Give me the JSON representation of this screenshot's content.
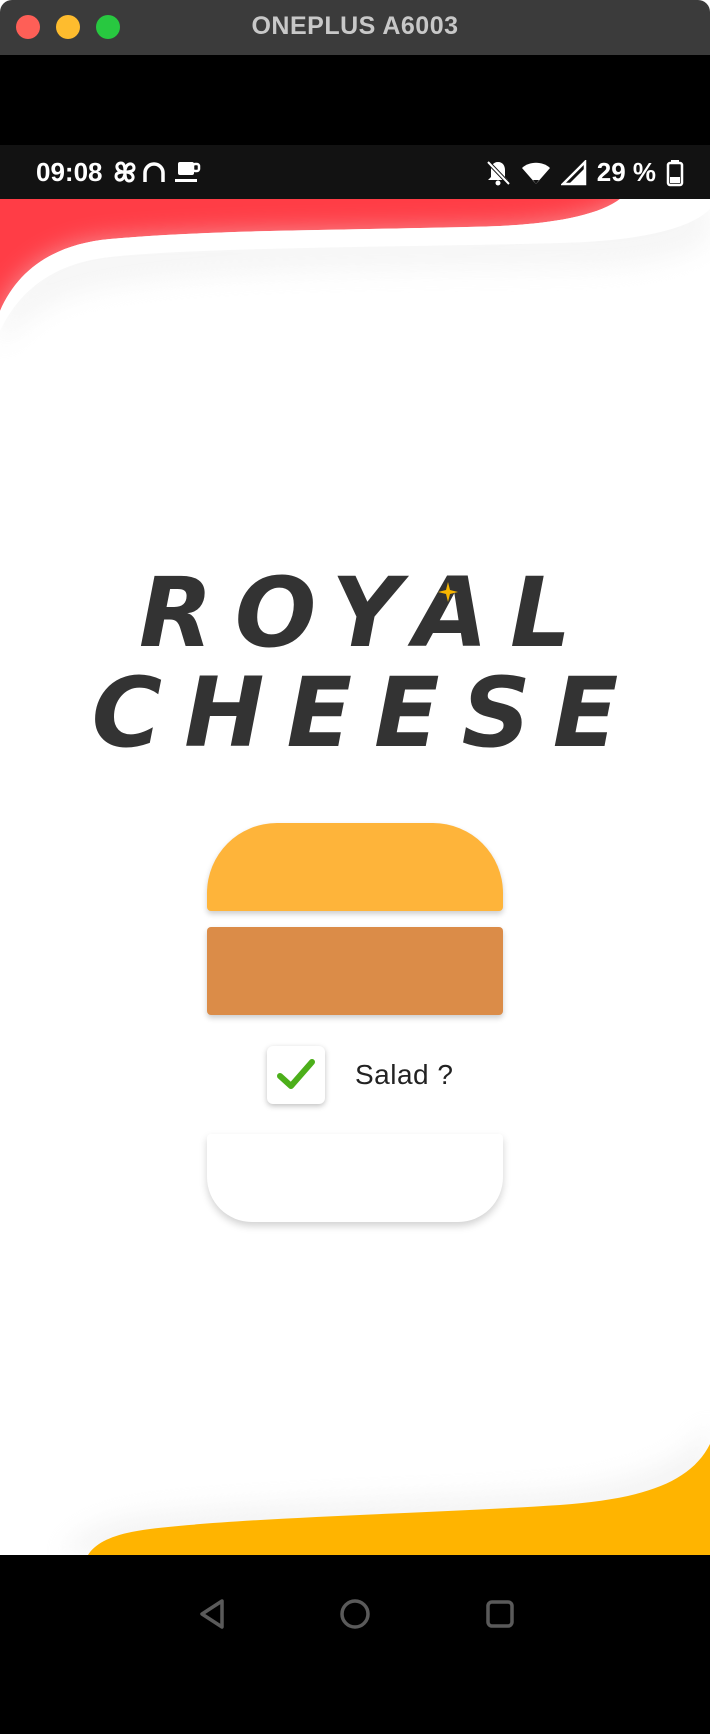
{
  "window": {
    "title": "ONEPLUS A6003"
  },
  "status_bar": {
    "time": "09:08",
    "battery": "29 %"
  },
  "app": {
    "title_line1": "ROYAL",
    "title_line2": "CHEESE",
    "salad_label": "Salad ?",
    "salad_checked": true
  },
  "colors": {
    "top_wave": "#ff3d46",
    "bottom_wave": "#ffb400",
    "bun_top": "#feb43a",
    "patty": "#db8c48",
    "title_text": "#333333",
    "check_green": "#4caf1a"
  },
  "icons": {
    "left_status": [
      "pinwheel-icon",
      "headset-icon",
      "coffee-icon"
    ],
    "right_status": [
      "bell-off-icon",
      "wifi-icon",
      "signal-icon",
      "battery-icon"
    ],
    "nav": [
      "back-icon",
      "home-icon",
      "recents-icon"
    ]
  }
}
